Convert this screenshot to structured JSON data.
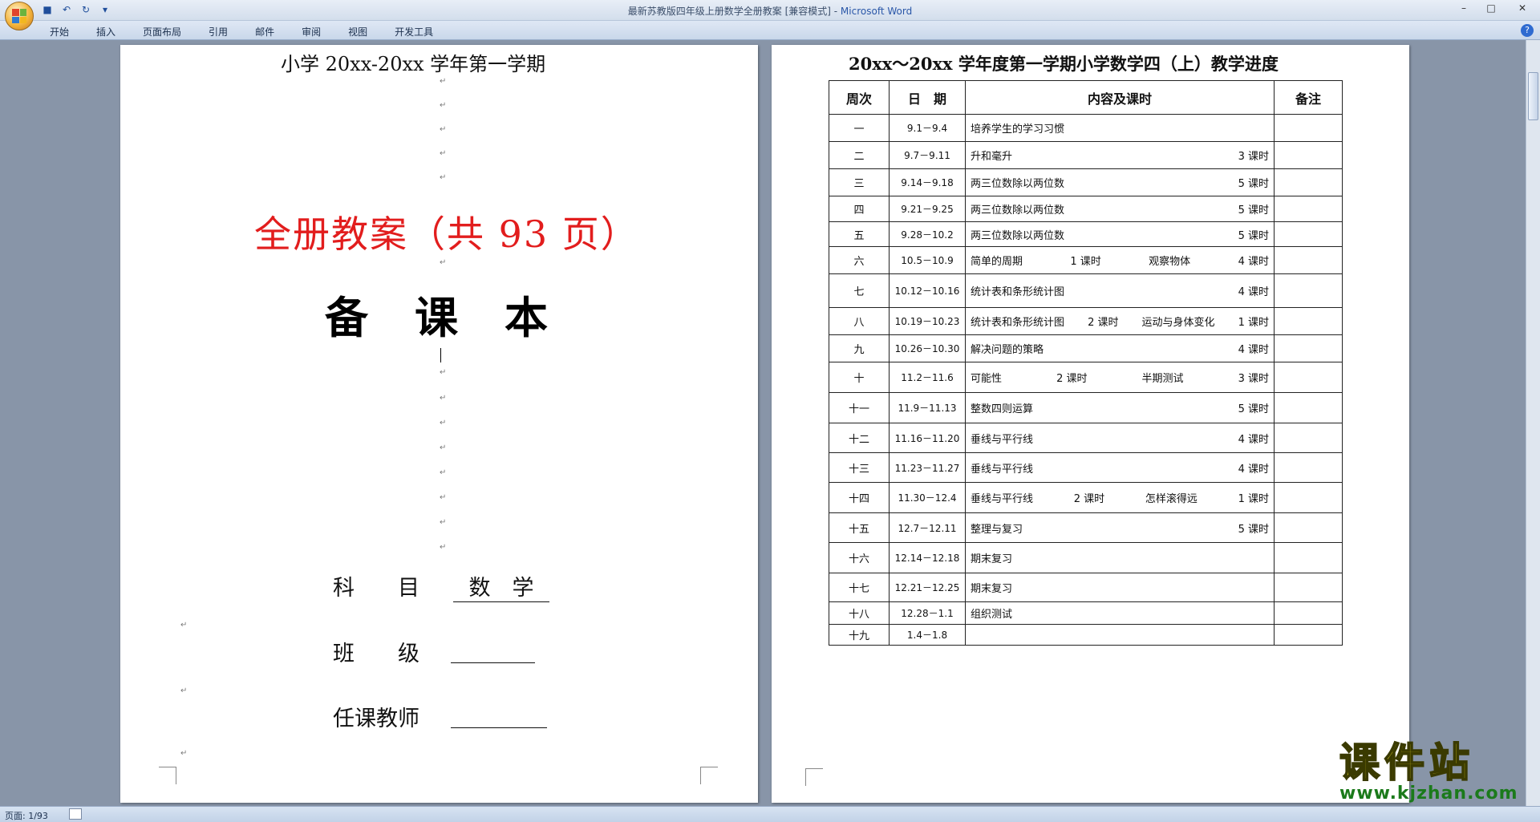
{
  "window": {
    "title_doc": "最新苏教版四年级上册数学全册教案 [兼容模式] - ",
    "title_app": "Microsoft Word"
  },
  "qat": {
    "dropdown": "▾"
  },
  "ribbon": {
    "tabs": [
      "开始",
      "插入",
      "页面布局",
      "引用",
      "邮件",
      "审阅",
      "视图",
      "开发工具"
    ],
    "help": "?"
  },
  "left_page": {
    "heading": "小学 20xx-20xx 学年第一学期",
    "red_title": "全册教案（共 93 页）",
    "book_title": "备课本",
    "subject_label": "科　　目",
    "subject_value": "数　学",
    "class_label": "班　　级",
    "teacher_label": "任课教师"
  },
  "right_page": {
    "title": "20xx～20xx 学年度第一学期小学数学四（上）教学进度",
    "headers": [
      "周次",
      "日　期",
      "内容及课时",
      "备注"
    ],
    "rows": [
      {
        "week": "一",
        "date": "9.1－9.4",
        "parts": [
          "培养学生的学习习惯"
        ],
        "hours": ""
      },
      {
        "week": "二",
        "date": "9.7－9.11",
        "parts": [
          "升和毫升"
        ],
        "hours": "3 课时"
      },
      {
        "week": "三",
        "date": "9.14－9.18",
        "parts": [
          "两三位数除以两位数"
        ],
        "hours": "5 课时"
      },
      {
        "week": "四",
        "date": "9.21－9.25",
        "parts": [
          "两三位数除以两位数"
        ],
        "hours": "5 课时"
      },
      {
        "week": "五",
        "date": "9.28－10.2",
        "parts": [
          "两三位数除以两位数"
        ],
        "hours": "5 课时"
      },
      {
        "week": "六",
        "date": "10.5－10.9",
        "parts": [
          "简单的周期",
          "1 课时",
          "观察物体"
        ],
        "hours": "4 课时"
      },
      {
        "week": "七",
        "date": "10.12－10.16",
        "parts": [
          "统计表和条形统计图"
        ],
        "hours": "4 课时"
      },
      {
        "week": "八",
        "date": "10.19－10.23",
        "parts": [
          "统计表和条形统计图",
          "2 课时",
          "运动与身体变化"
        ],
        "hours": "1 课时"
      },
      {
        "week": "九",
        "date": "10.26－10.30",
        "parts": [
          "解决问题的策略"
        ],
        "hours": "4 课时"
      },
      {
        "week": "十",
        "date": "11.2－11.6",
        "parts": [
          "可能性",
          "2 课时",
          "半期测试"
        ],
        "hours": "3 课时"
      },
      {
        "week": "十一",
        "date": "11.9－11.13",
        "parts": [
          "整数四则运算"
        ],
        "hours": "5 课时"
      },
      {
        "week": "十二",
        "date": "11.16－11.20",
        "parts": [
          "垂线与平行线"
        ],
        "hours": "4 课时"
      },
      {
        "week": "十三",
        "date": "11.23－11.27",
        "parts": [
          "垂线与平行线"
        ],
        "hours": "4 课时"
      },
      {
        "week": "十四",
        "date": "11.30－12.4",
        "parts": [
          "垂线与平行线",
          "2 课时",
          "怎样滚得远"
        ],
        "hours": "1 课时"
      },
      {
        "week": "十五",
        "date": "12.7－12.11",
        "parts": [
          "整理与复习"
        ],
        "hours": "5 课时"
      },
      {
        "week": "十六",
        "date": "12.14－12.18",
        "parts": [
          "期末复习"
        ],
        "hours": ""
      },
      {
        "week": "十七",
        "date": "12.21－12.25",
        "parts": [
          "期末复习"
        ],
        "hours": ""
      },
      {
        "week": "十八",
        "date": "12.28－1.1",
        "parts": [
          "组织测试"
        ],
        "hours": ""
      },
      {
        "week": "十九",
        "date": "1.4－1.8",
        "parts": [
          ""
        ],
        "hours": ""
      }
    ]
  },
  "watermark": {
    "cn": "课件站",
    "url": "www.kjzhan.com"
  },
  "status": {
    "page": "页面: 1/93"
  },
  "colors": {
    "red_title": "#e21d1d",
    "watermark_yellow": "#f5e32a",
    "watermark_green": "#1b7a1b"
  }
}
